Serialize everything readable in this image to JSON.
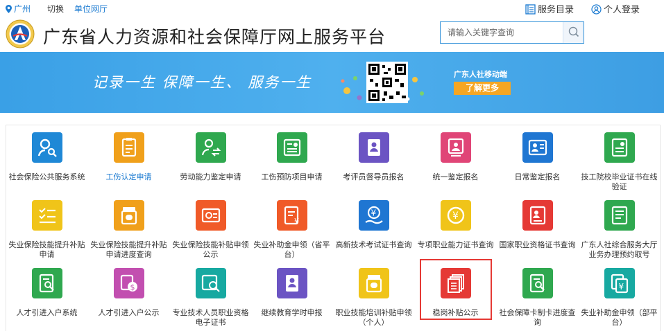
{
  "topbar": {
    "location": "广州",
    "switch": "切换",
    "hall": "单位网厅",
    "service_catalog": "服务目录",
    "login": "个人登录"
  },
  "header": {
    "title": "广东省人力资源和社会保障厅网上服务平台",
    "search_placeholder": "请输入关键字查询"
  },
  "banner": {
    "slogan": "记录一生   保障一生、  服务一生",
    "mobile": "广东人社移动端",
    "more": "了解更多"
  },
  "services": [
    {
      "label": "社会保险公共服务系统",
      "color": "#1f88d6",
      "icon": "person-search-icon"
    },
    {
      "label": "工伤认定申请",
      "color": "#f0a01b",
      "icon": "document-icon"
    },
    {
      "label": "劳动能力鉴定申请",
      "color": "#2fa84f",
      "icon": "people-refresh-icon"
    },
    {
      "label": "工伤预防项目申请",
      "color": "#2fa84f",
      "icon": "certificate-icon"
    },
    {
      "label": "考评员督导员报名",
      "color": "#6b54c3",
      "icon": "register-icon"
    },
    {
      "label": "统一鉴定报名",
      "color": "#e04577",
      "icon": "appraisal-icon"
    },
    {
      "label": "日常鉴定报名",
      "color": "#1f76d2",
      "icon": "id-card-icon"
    },
    {
      "label": "技工院校毕业证书在线验证",
      "color": "#2fa84f",
      "icon": "diploma-icon"
    },
    {
      "label": "失业保险技能提升补贴申请",
      "color": "#f0c419",
      "icon": "checklist-icon"
    },
    {
      "label": "失业保险技能提升补贴申请进度查询",
      "color": "#f0a01b",
      "icon": "medicine-icon"
    },
    {
      "label": "失业保险技能补贴申领公示",
      "color": "#f05a28",
      "icon": "card-icon"
    },
    {
      "label": "失业补助金申领（省平台）",
      "color": "#f05a28",
      "icon": "yuan-doc-icon"
    },
    {
      "label": "高新技术考试证书查询",
      "color": "#1f76d2",
      "icon": "yuan-hand-icon"
    },
    {
      "label": "专项职业能力证书查询",
      "color": "#f0c419",
      "icon": "yuan-circle-icon"
    },
    {
      "label": "国家职业资格证书查询",
      "color": "#e53935",
      "icon": "profile-card-icon"
    },
    {
      "label": "广东人社综合服务大厅业务办理预约取号",
      "color": "#2fa84f",
      "icon": "ticket-icon"
    },
    {
      "label": "人才引进入户系统",
      "color": "#2fa84f",
      "icon": "doc-search-icon"
    },
    {
      "label": "人才引进入户公示",
      "color": "#c24fb0",
      "icon": "dollar-doc-icon"
    },
    {
      "label": "专业技术人员职业资格电子证书",
      "color": "#17a9a1",
      "icon": "cert-search-icon"
    },
    {
      "label": "继续教育学时申报",
      "color": "#6b54c3",
      "icon": "education-icon"
    },
    {
      "label": "职业技能培训补贴申领（个人）",
      "color": "#f0c419",
      "icon": "medicine-icon"
    },
    {
      "label": "稳岗补贴公示",
      "color": "#e53935",
      "icon": "stack-doc-icon"
    },
    {
      "label": "社会保障卡制卡进度查询",
      "color": "#2fa84f",
      "icon": "doc-search-icon"
    },
    {
      "label": "失业补助金申领（部平台）",
      "color": "#17a9a1",
      "icon": "yuan-stack-icon"
    }
  ]
}
